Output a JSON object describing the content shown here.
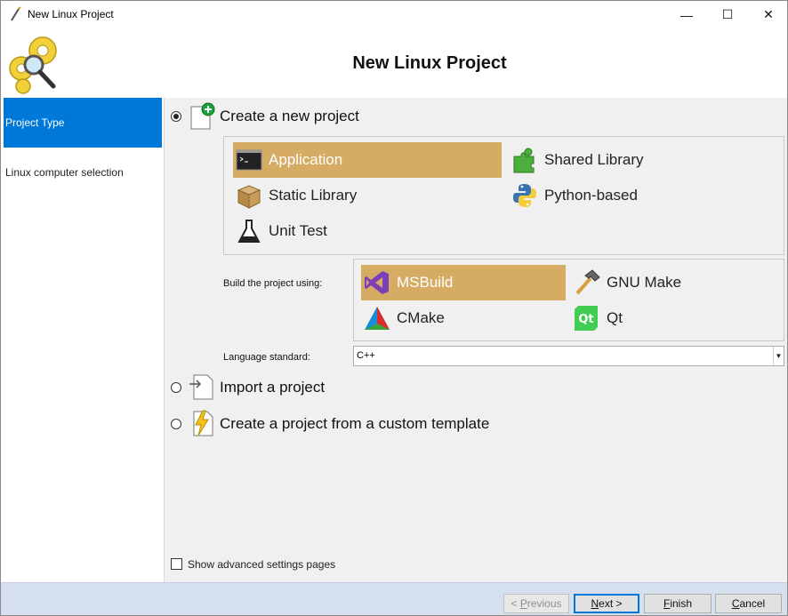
{
  "window": {
    "title": "New Linux Project",
    "controls": {
      "minimize": "—",
      "maximize": "☐",
      "close": "✕"
    }
  },
  "header": {
    "heading": "New Linux Project"
  },
  "sidebar": {
    "items": [
      {
        "label": "Project Type",
        "active": true
      },
      {
        "label": "Linux computer selection",
        "active": false
      }
    ]
  },
  "options": {
    "create_new": {
      "label": "Create a new project",
      "checked": true
    },
    "import": {
      "label": "Import a project",
      "checked": false
    },
    "custom_template": {
      "label": "Create a project from a custom template",
      "checked": false
    }
  },
  "project_types": [
    {
      "label": "Application",
      "icon": "console-icon",
      "selected": true
    },
    {
      "label": "Shared Library",
      "icon": "puzzle-icon",
      "selected": false
    },
    {
      "label": "Static Library",
      "icon": "box-icon",
      "selected": false
    },
    {
      "label": "Python-based",
      "icon": "python-icon",
      "selected": false
    },
    {
      "label": "Unit Test",
      "icon": "flask-icon",
      "selected": false
    }
  ],
  "build": {
    "label": "Build the project using:",
    "systems": [
      {
        "label": "MSBuild",
        "icon": "visual-studio-icon",
        "selected": true
      },
      {
        "label": "GNU Make",
        "icon": "hammer-icon",
        "selected": false
      },
      {
        "label": "CMake",
        "icon": "cmake-icon",
        "selected": false
      },
      {
        "label": "Qt",
        "icon": "qt-icon",
        "selected": false
      }
    ]
  },
  "language": {
    "label": "Language standard:",
    "value": "C++"
  },
  "advanced": {
    "label": "Show advanced settings pages",
    "checked": false
  },
  "footer": {
    "previous": {
      "underline": "P",
      "rest": "revious",
      "prefix": "< "
    },
    "next": {
      "underline": "N",
      "rest": "ext >"
    },
    "finish": {
      "underline": "F",
      "rest": "inish"
    },
    "cancel": {
      "underline": "C",
      "rest": "ancel"
    }
  },
  "colors": {
    "accent": "#0078d7",
    "selected_tile": "#d6ab64",
    "footer_bg": "#d6dfee"
  }
}
